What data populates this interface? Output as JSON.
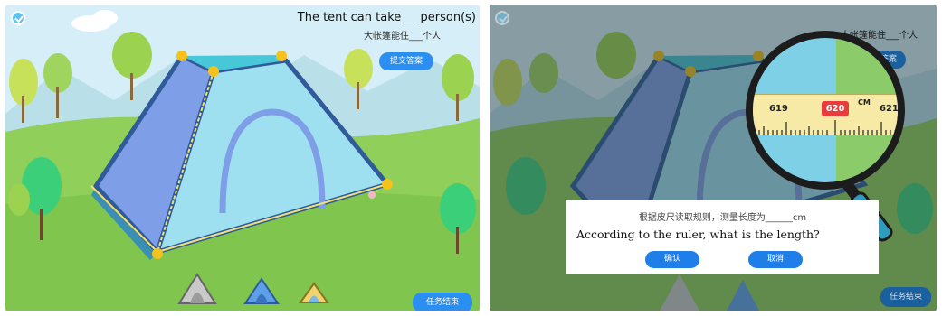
{
  "left_panel": {
    "question_en": "The tent can take __ person(s)",
    "question_cn": "大帐篷能住___个人",
    "submit_button": "提交答案",
    "end_task_button": "任务结束",
    "tent_options": [
      "grey-tent",
      "blue-tent",
      "yellow-tent"
    ]
  },
  "right_panel": {
    "question_cn": "大帐篷能住___个人",
    "submit_button": "提交答案",
    "end_task_button": "任务结束",
    "dialog": {
      "prompt_cn": "根据皮尺读取规则，测量长度为______cm",
      "prompt_en": "According to the ruler, what is the length?",
      "confirm_button": "确认",
      "cancel_button": "取消"
    },
    "magnifier": {
      "ruler_labels": [
        "619",
        "620",
        "621"
      ],
      "highlighted_value": "620",
      "unit": "CM"
    }
  },
  "colors": {
    "sky": "#d6eef7",
    "grass": "#8fcf5a",
    "tent_body": "#9fe0f0",
    "tent_side": "#7f9ee8",
    "button_blue": "#2a8ff0",
    "ruler_highlight": "#ea3c3c"
  }
}
